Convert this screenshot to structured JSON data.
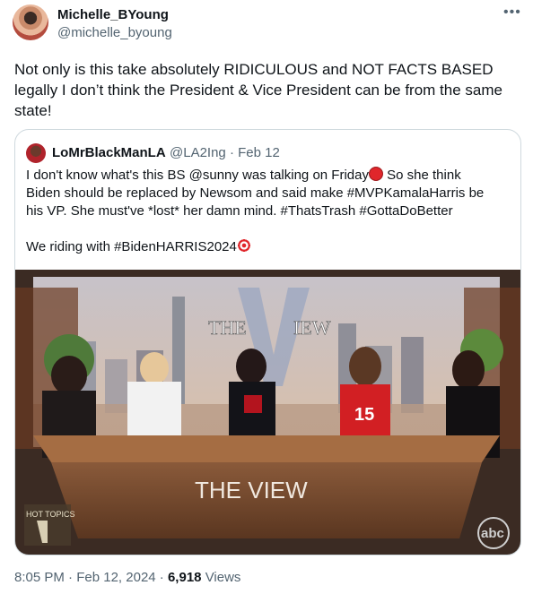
{
  "author": {
    "name": "Michelle_BYoung",
    "handle": "@michelle_byoung"
  },
  "tweet": {
    "text": "Not only is this take absolutely RIDICULOUS and NOT FACTS BASED legally I don’t think the President & Vice President can be from the same state!"
  },
  "quote": {
    "name": "LoMrBlackManLA",
    "handle": "@LA2Ing",
    "date": "Feb 12",
    "meta_separator": "·",
    "line1a": "I don't know what's this BS @sunny was talking on Friday",
    "line1b": " So she think",
    "line2": "Biden should be replaced by Newsom and said make #MVPKamalaHarris be",
    "line3": "his VP. She must've *lost* her damn mind. #ThatsTrash #GottaDoBetter",
    "line4": "We riding with #BidenHARRIS2024",
    "media": {
      "sign_left": "THE",
      "sign_right": "IEW",
      "desk_text": "THE VIEW",
      "corner_label": "HOT TOPICS",
      "network_logo": "abc",
      "shirt_text": "15"
    }
  },
  "footer": {
    "time": "8:05 PM",
    "date": "Feb 12, 2024",
    "views_count": "6,918",
    "views_label": "Views",
    "sep": "·"
  },
  "icons": {
    "more": "more-horizontal-icon",
    "angry_emoji": "angry-face-emoji-icon",
    "target_emoji": "bullseye-emoji-icon"
  }
}
